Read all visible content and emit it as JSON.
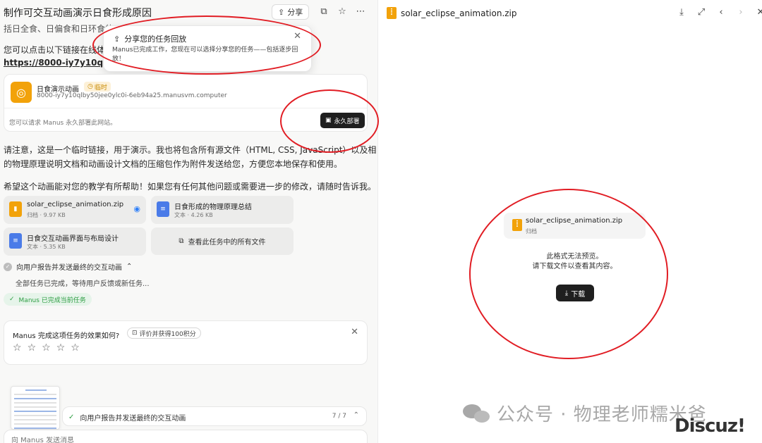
{
  "task": {
    "title": "制作可交互动画演示日食形成原因",
    "share_label": "分享"
  },
  "messages": {
    "truncated_line": "括日全食、日偏食和日环食的",
    "link_intro": "您可以点击以下链接在线体",
    "link_text": "https://8000-iy7y10qlby50j",
    "note": "请注意，这是一个临时链接，用于演示。我也将包含所有源文件（HTML, CSS, JavaScript）以及相关",
    "note_2": "的物理原理说明文档和动画设计文档的压缩包作为附件发送给您，方便您本地保存和使用。",
    "closing": "希望这个动画能对您的教学有所帮助！如果您有任何其他问题或需要进一步的修改，请随时告诉我。"
  },
  "share_popup": {
    "title": "分享您的任务回放",
    "desc": "Manus已完成工作，您现在可以选择分享您的任务——包括逐步回放！"
  },
  "website_card": {
    "name": "日食演示动画",
    "tag": "临时",
    "url": "8000-iy7y10qlby50jee0ylc0i-6eb94a25.manusvm.computer",
    "note": "您可以请求 Manus 永久部署此网站。",
    "deploy_label": "永久部署"
  },
  "attachments": [
    {
      "name": "solar_eclipse_animation.zip",
      "meta": "归档 · 9.97 KB",
      "icon": "zip-file-icon",
      "color": "#f2a20a"
    },
    {
      "name": "日食形成的物理原理总结",
      "meta": "文本 · 4.26 KB",
      "icon": "doc-file-icon",
      "color": "#4a7be8"
    },
    {
      "name": "日食交互动画界面与布局设计",
      "meta": "文本 · 5.35 KB",
      "icon": "doc-file-icon",
      "color": "#4a7be8"
    }
  ],
  "view_all_label": "查看此任务中的所有文件",
  "status": {
    "step": "向用户报告并发送最终的交互动画",
    "sub": "全部任务已完成，等待用户反馈或新任务...",
    "done": "Manus 已完成当前任务"
  },
  "rating": {
    "question": "Manus 完成这项任务的效果如何?",
    "pill": "评价并获得100积分",
    "stars": 5
  },
  "progress": {
    "label": "向用户报告并发送最终的交互动画",
    "count": "7 / 7"
  },
  "input": {
    "placeholder": "向 Manus 发送消息"
  },
  "preview": {
    "file_name": "solar_eclipse_animation.zip",
    "file_kind": "归档",
    "message_1": "此格式无法预览。",
    "message_2": "请下载文件以查看其内容。",
    "download_label": "下载"
  },
  "watermark": {
    "text": "公众号 · 物理老师糯米爸",
    "brand": "Discuz!"
  },
  "colors": {
    "accent_dark": "#1f1f1f",
    "zip_orange": "#f2a20a",
    "doc_blue": "#4a7be8",
    "success_green": "#2f9e44",
    "annotation_red": "#e11d24"
  }
}
